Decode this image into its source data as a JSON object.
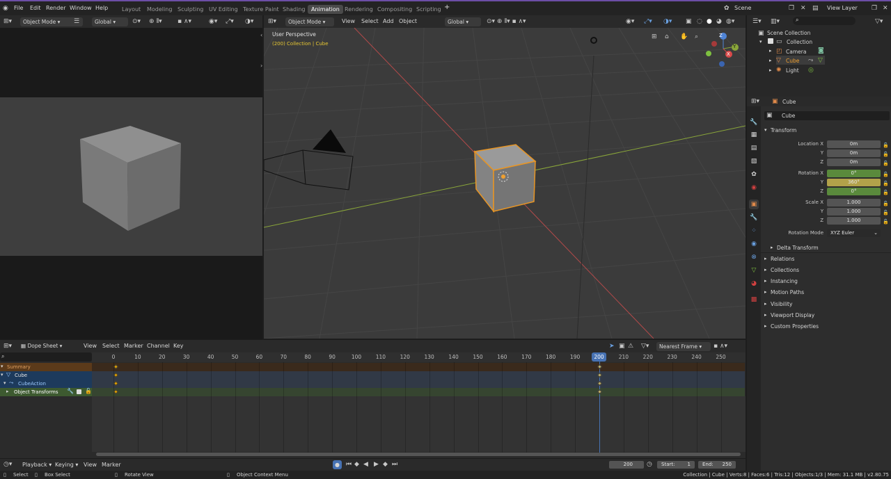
{
  "topbar": {
    "menus": [
      "File",
      "Edit",
      "Render",
      "Window",
      "Help"
    ],
    "workspaces": [
      "Layout",
      "Modeling",
      "Sculpting",
      "UV Editing",
      "Texture Paint",
      "Shading",
      "Animation",
      "Rendering",
      "Compositing",
      "Scripting"
    ],
    "active_workspace": "Animation",
    "scene": "Scene",
    "view_layer": "View Layer",
    "add_tab": "+"
  },
  "left_header": {
    "mode": "Object Mode",
    "orientation": "Global"
  },
  "viewport": {
    "mode": "Object Mode",
    "menus": [
      "View",
      "Select",
      "Add",
      "Object"
    ],
    "orientation": "Global",
    "overlay_title": "User Perspective",
    "overlay_sub": "(200) Collection | Cube",
    "gizmo": {
      "x": "X",
      "y": "Y",
      "z": "Z"
    }
  },
  "outliner": {
    "scene_collection": "Scene Collection",
    "collection": "Collection",
    "items": [
      "Camera",
      "Cube",
      "Light"
    ]
  },
  "properties": {
    "object_name": "Cube",
    "datablock": "Cube",
    "transform_label": "Transform",
    "location": {
      "label": "Location X",
      "x": "0m",
      "y": "0m",
      "z": "0m"
    },
    "rotation": {
      "label": "Rotation X",
      "x": "0°",
      "y": "360°",
      "z": "0°"
    },
    "scale": {
      "label": "Scale X",
      "x": "1.000",
      "y": "1.000",
      "z": "1.000"
    },
    "axis_y": "Y",
    "axis_z": "Z",
    "rotation_mode_label": "Rotation Mode",
    "rotation_mode": "XYZ Euler",
    "delta": "Delta Transform",
    "sections": [
      "Relations",
      "Collections",
      "Instancing",
      "Motion Paths",
      "Visibility",
      "Viewport Display",
      "Custom Properties"
    ]
  },
  "dopesheet": {
    "mode": "Dope Sheet",
    "menus": [
      "View",
      "Select",
      "Marker",
      "Channel",
      "Key"
    ],
    "snap": "Nearest Frame",
    "ticks": [
      "0",
      "10",
      "20",
      "30",
      "40",
      "50",
      "60",
      "70",
      "80",
      "90",
      "100",
      "110",
      "120",
      "130",
      "140",
      "150",
      "160",
      "170",
      "180",
      "190",
      "200",
      "210",
      "220",
      "230",
      "240",
      "250"
    ],
    "current_frame": "200",
    "channels": {
      "summary": "Summary",
      "cube": "Cube",
      "action": "CubeAction",
      "transforms": "Object Transforms"
    }
  },
  "timeline": {
    "menus": [
      "Playback",
      "Keying",
      "View",
      "Marker"
    ],
    "frame": "200",
    "start_label": "Start:",
    "start": "1",
    "end_label": "End:",
    "end": "250"
  },
  "status": {
    "select": "Select",
    "box_select": "Box Select",
    "rotate": "Rotate View",
    "context": "Object Context Menu",
    "stats": "Collection | Cube | Verts:8 | Faces:6 | Tris:12 | Objects:1/3 | Mem: 31.1 MB | v2.80.75"
  },
  "colors": {
    "accent": "#4772b3",
    "selected": "#e89524",
    "keyframe": "#e0a000",
    "summary_row": "#5b3a1a",
    "cube_row": "#1d3a5c",
    "transforms_row": "#3d5a30"
  }
}
